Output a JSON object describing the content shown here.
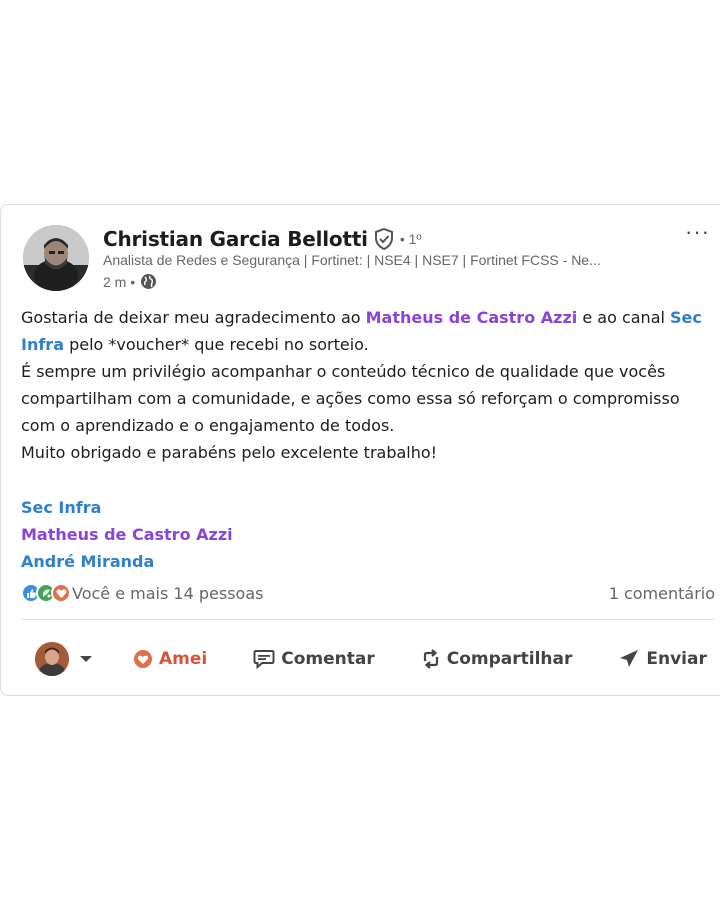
{
  "post": {
    "author_name": "Christian Garcia Bellotti",
    "degree": "• 1º",
    "headline": "Analista de Redes e Segurança | Fortinet: | NSE4 | NSE7 | Fortinet FCSS - Ne...",
    "time": "2 m •",
    "more_label": "···",
    "body": {
      "p1_a": "Gostaria de deixar meu agradecimento ao ",
      "p1_mention1": "Matheus de Castro Azzi",
      "p1_b": " e ao canal ",
      "p1_mention2": "Sec Infra",
      "p1_c": " pelo *voucher* que recebi no sorteio.",
      "p2": " É sempre um privilégio acompanhar o conteúdo técnico de qualidade que vocês compartilham com a comunidade, e ações como essa só reforçam o compromisso com o aprendizado e o engajamento de todos.",
      "p3": " Muito obrigado e parabéns pelo excelente trabalho!"
    },
    "tags": [
      "Sec Infra",
      "Matheus de Castro Azzi",
      "André Miranda"
    ],
    "reactions_text": "Você e mais 14 pessoas",
    "comments_text": "1 comentário",
    "actions": {
      "love": "Amei",
      "comment": "Comentar",
      "repost": "Compartilhar",
      "send": "Enviar"
    }
  },
  "colors": {
    "mention_purple": "#8a45d6",
    "mention_blue": "#2f7fcf",
    "love_red": "#d5553c",
    "muted": "#666666"
  },
  "icons": [
    "verified-shield-icon",
    "globe-icon",
    "more-icon",
    "like-reaction-icon",
    "celebrate-reaction-icon",
    "love-reaction-icon",
    "caret-down-icon",
    "heart-icon",
    "comment-icon",
    "repost-icon",
    "send-icon"
  ]
}
